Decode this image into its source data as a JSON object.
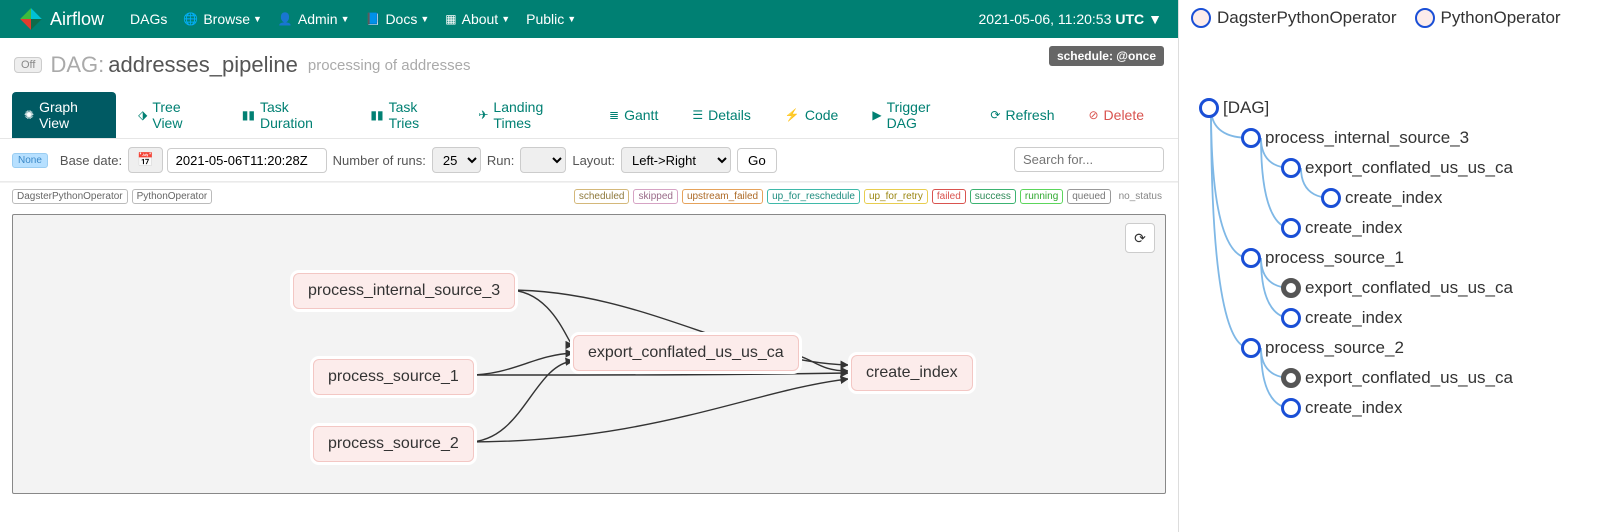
{
  "nav": {
    "brand": "Airflow",
    "items": [
      "DAGs",
      "Browse",
      "Admin",
      "Docs",
      "About",
      "Public"
    ],
    "has_dropdown": [
      false,
      true,
      true,
      true,
      true,
      true
    ],
    "icons": [
      "",
      "globe",
      "user",
      "book",
      "grid",
      ""
    ],
    "clock": "2021-05-06, 11:20:53",
    "tz": "UTC"
  },
  "dag": {
    "toggle": "Off",
    "label": "DAG:",
    "name": "addresses_pipeline",
    "desc": "processing of addresses",
    "schedule": "schedule: @once"
  },
  "tabs": {
    "graph": "Graph View",
    "tree": "Tree View",
    "duration": "Task Duration",
    "tries": "Task Tries",
    "landing": "Landing Times",
    "gantt": "Gantt",
    "details": "Details",
    "code": "Code",
    "trigger": "Trigger DAG",
    "refresh": "Refresh",
    "delete": "Delete"
  },
  "controls": {
    "none": "None",
    "base_date_label": "Base date:",
    "base_date": "2021-05-06T11:20:28Z",
    "runs_label": "Number of runs:",
    "runs": "25",
    "run_label": "Run:",
    "run": "",
    "layout_label": "Layout:",
    "layout": "Left->Right",
    "go": "Go",
    "search_placeholder": "Search for..."
  },
  "operators": [
    "DagsterPythonOperator",
    "PythonOperator"
  ],
  "statuses": {
    "scheduled": "scheduled",
    "skipped": "skipped",
    "upstream_failed": "upstream_failed",
    "up_for_reschedule": "up_for_reschedule",
    "up_for_retry": "up_for_retry",
    "failed": "failed",
    "success": "success",
    "running": "running",
    "queued": "queued",
    "no_status": "no_status"
  },
  "graph_nodes": {
    "n0": "process_internal_source_3",
    "n1": "process_source_1",
    "n2": "process_source_2",
    "n3": "export_conflated_us_us_ca",
    "n4": "create_index"
  },
  "right": {
    "legend1": "DagsterPythonOperator",
    "legend2": "PythonOperator",
    "tree": {
      "t0": "[DAG]",
      "t1": "process_internal_source_3",
      "t2": "export_conflated_us_us_ca",
      "t3": "create_index",
      "t4": "create_index",
      "t5": "process_source_1",
      "t6": "export_conflated_us_us_ca",
      "t7": "create_index",
      "t8": "process_source_2",
      "t9": "export_conflated_us_us_ca",
      "t10": "create_index"
    }
  }
}
